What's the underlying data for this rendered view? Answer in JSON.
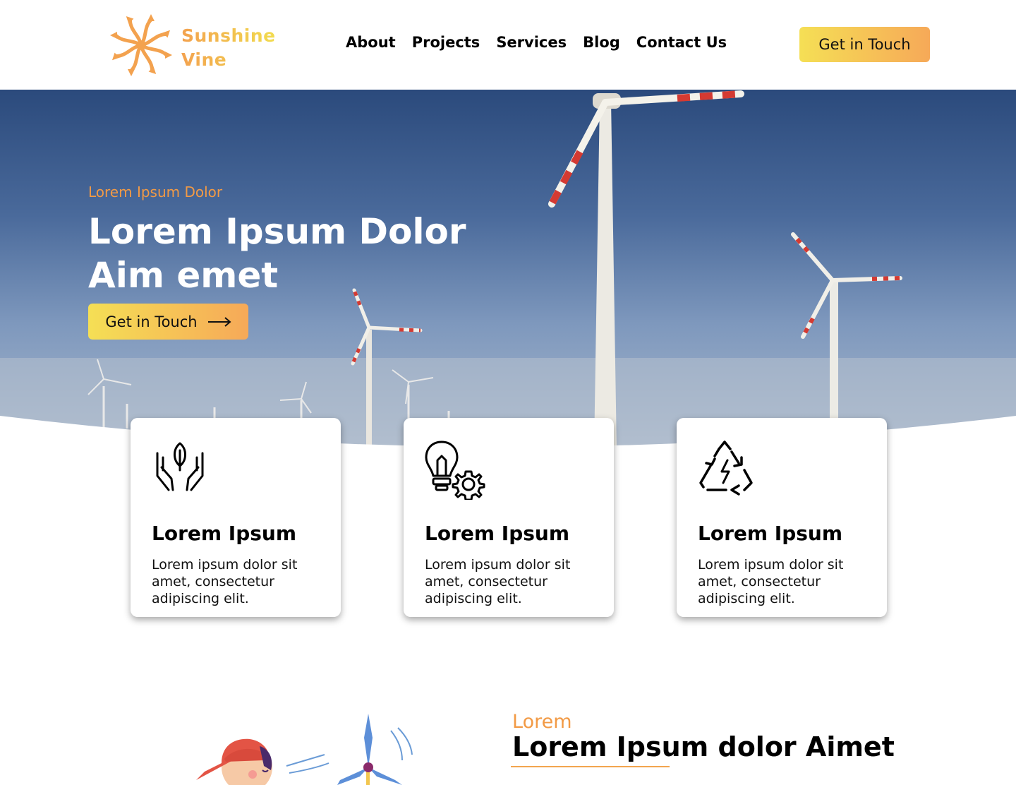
{
  "brand": {
    "name_line1": "Sunshine",
    "name_line2": "Vine",
    "accent": "#f29a45",
    "accent_yellow": "#f5df55"
  },
  "nav": {
    "items": [
      "About",
      "Projects",
      "Services",
      "Blog",
      "Contact Us"
    ],
    "cta": "Get in Touch"
  },
  "hero": {
    "eyebrow": "Lorem Ipsum Dolor",
    "title_line1": "Lorem Ipsum Dolor",
    "title_line2": "Aim emet",
    "cta": "Get in Touch",
    "cta_icon": "arrow-right-icon"
  },
  "features": [
    {
      "icon": "hands-leaf-icon",
      "title": "Lorem Ipsum",
      "text": "Lorem ipsum dolor sit amet, consectetur adipiscing elit."
    },
    {
      "icon": "lightbulb-gear-icon",
      "title": "Lorem Ipsum",
      "text": "Lorem ipsum dolor sit amet, consectetur adipiscing elit."
    },
    {
      "icon": "recycle-bolt-icon",
      "title": "Lorem Ipsum",
      "text": "Lorem ipsum dolor sit amet, consectetur adipiscing elit."
    }
  ],
  "section": {
    "eyebrow": "Lorem",
    "title": "Lorem Ipsum dolor Aimet"
  }
}
